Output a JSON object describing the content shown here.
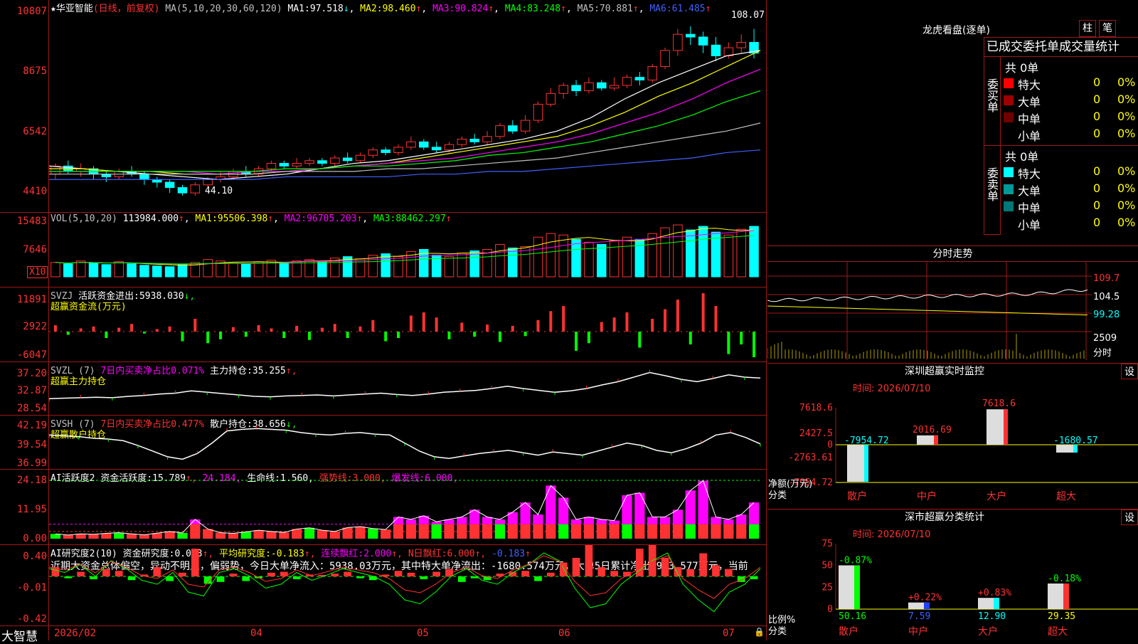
{
  "colors": {
    "up": "#ff3232",
    "down": "#00ffff",
    "ma1": "#ffffff",
    "ma2": "#ffff00",
    "ma3": "#ff00ff",
    "ma4": "#00ff00",
    "ma5": "#c0c0c0",
    "ma6": "#4060ff",
    "grid": "#a01818"
  },
  "kline": {
    "title_star": "★",
    "name": "华亚智能",
    "mode": "(日线，前复权)",
    "ma_spec": "MA(5,10,20,30,60,120)",
    "ma": [
      {
        "label": "MA1:",
        "value": "97.518",
        "arrow": "↓"
      },
      {
        "label": "MA2:",
        "value": "98.460",
        "arrow": "↑"
      },
      {
        "label": "MA3:",
        "value": "90.824",
        "arrow": "↑"
      },
      {
        "label": "MA4:",
        "value": "83.248",
        "arrow": "↑"
      },
      {
        "label": "MA5:",
        "value": "70.881",
        "arrow": "↑"
      },
      {
        "label": "MA6:",
        "value": "61.485",
        "arrow": "↑"
      }
    ],
    "yticks": [
      "10807",
      "8675",
      "6542",
      "4410"
    ],
    "high_label": "108.07",
    "low_label": "44.10",
    "candles": [
      [
        52,
        55,
        50,
        56
      ],
      [
        55,
        53,
        52,
        57
      ],
      [
        53,
        54,
        51,
        56
      ],
      [
        54,
        52,
        50,
        55
      ],
      [
        52,
        51,
        49,
        53
      ],
      [
        51,
        53,
        50,
        54
      ],
      [
        53,
        52,
        51,
        55
      ],
      [
        52,
        50,
        48,
        53
      ],
      [
        50,
        49,
        47,
        51
      ],
      [
        49,
        47,
        45,
        50
      ],
      [
        47,
        45,
        44,
        48
      ],
      [
        45,
        48,
        44,
        49
      ],
      [
        48,
        50,
        47,
        51
      ],
      [
        50,
        51,
        49,
        53
      ],
      [
        51,
        53,
        50,
        54
      ],
      [
        53,
        52,
        51,
        55
      ],
      [
        52,
        54,
        51,
        55
      ],
      [
        54,
        56,
        53,
        57
      ],
      [
        56,
        55,
        54,
        57
      ],
      [
        55,
        56,
        54,
        58
      ],
      [
        56,
        57,
        55,
        58
      ],
      [
        57,
        56,
        55,
        58
      ],
      [
        56,
        58,
        55,
        59
      ],
      [
        58,
        57,
        56,
        60
      ],
      [
        57,
        59,
        56,
        60
      ],
      [
        59,
        61,
        58,
        62
      ],
      [
        61,
        60,
        59,
        62
      ],
      [
        60,
        62,
        59,
        63
      ],
      [
        62,
        64,
        61,
        66
      ],
      [
        64,
        62,
        61,
        65
      ],
      [
        62,
        61,
        60,
        64
      ],
      [
        61,
        63,
        60,
        64
      ],
      [
        63,
        65,
        62,
        66
      ],
      [
        65,
        64,
        63,
        67
      ],
      [
        64,
        66,
        63,
        68
      ],
      [
        66,
        70,
        65,
        71
      ],
      [
        70,
        68,
        67,
        72
      ],
      [
        68,
        72,
        67,
        74
      ],
      [
        72,
        78,
        71,
        79
      ],
      [
        78,
        82,
        77,
        84
      ],
      [
        82,
        85,
        80,
        86
      ],
      [
        85,
        83,
        81,
        87
      ],
      [
        83,
        86,
        82,
        88
      ],
      [
        86,
        84,
        83,
        87
      ],
      [
        84,
        85,
        83,
        88
      ],
      [
        85,
        88,
        84,
        89
      ],
      [
        88,
        87,
        85,
        90
      ],
      [
        87,
        92,
        86,
        93
      ],
      [
        92,
        98,
        91,
        99
      ],
      [
        98,
        104,
        96,
        106
      ],
      [
        104,
        103,
        100,
        107
      ],
      [
        103,
        100,
        97,
        105
      ],
      [
        100,
        96,
        94,
        103
      ],
      [
        96,
        99,
        95,
        101
      ],
      [
        99,
        101,
        97,
        104
      ],
      [
        101,
        97,
        95,
        106
      ]
    ],
    "ma_lines": [
      [
        55,
        54,
        53,
        52,
        51,
        50,
        51,
        52,
        54,
        56,
        57,
        59,
        61,
        63,
        65,
        68,
        73,
        80,
        86,
        91,
        96,
        98
      ],
      [
        54,
        54,
        53,
        53,
        52,
        52,
        52,
        53,
        54,
        55,
        56,
        58,
        60,
        62,
        64,
        66,
        70,
        75,
        81,
        86,
        92,
        98
      ],
      [
        53,
        53,
        53,
        53,
        53,
        52,
        53,
        53,
        54,
        55,
        56,
        57,
        58,
        60,
        62,
        64,
        67,
        71,
        75,
        80,
        86,
        91
      ],
      [
        53,
        53,
        53,
        53,
        53,
        53,
        53,
        54,
        54,
        55,
        55,
        56,
        57,
        59,
        60,
        62,
        64,
        67,
        70,
        74,
        79,
        83
      ],
      [
        52,
        52,
        52,
        52,
        52,
        52,
        52,
        53,
        53,
        53,
        54,
        54,
        55,
        56,
        57,
        58,
        60,
        62,
        64,
        66,
        68,
        71
      ],
      [
        50,
        50,
        50,
        50,
        50,
        50,
        50,
        51,
        51,
        51,
        51,
        52,
        52,
        53,
        53,
        54,
        55,
        56,
        57,
        58,
        60,
        61
      ]
    ]
  },
  "vol": {
    "label": "VOL(5,10,20)",
    "value": "113984.000",
    "arrow": "↑",
    "ma": [
      {
        "label": "MA1:",
        "value": "95506.398",
        "arrow": "↑"
      },
      {
        "label": "MA2:",
        "value": "96705.203",
        "arrow": "↑"
      },
      {
        "label": "MA3:",
        "value": "88462.297",
        "arrow": "↑"
      }
    ],
    "yticks": [
      "15483",
      "7646"
    ],
    "unit": "X10",
    "bars": [
      20,
      18,
      22,
      19,
      17,
      21,
      18,
      16,
      15,
      14,
      17,
      20,
      24,
      22,
      19,
      18,
      21,
      23,
      20,
      22,
      24,
      21,
      26,
      28,
      25,
      30,
      32,
      28,
      35,
      38,
      30,
      28,
      33,
      36,
      38,
      45,
      40,
      42,
      55,
      60,
      58,
      52,
      48,
      45,
      50,
      55,
      52,
      60,
      68,
      72,
      65,
      70,
      62,
      58,
      66,
      70
    ]
  },
  "svzj": {
    "label": "SVZJ",
    "sub1": "活跃资金进出:",
    "v1": "5938.030",
    "a1": "↓,",
    "line2": "超赢资金流(万元)",
    "yticks": [
      "11891",
      "2922",
      "-6047"
    ],
    "bars": [
      1,
      -0.5,
      0.5,
      0.8,
      -1,
      0.6,
      1.2,
      -0.3,
      0.4,
      0.8,
      -1.5,
      2,
      -1.8,
      -1.2,
      0.7,
      -0.8,
      1,
      0.5,
      -1,
      0.9,
      -1.3,
      0.6,
      1.2,
      -1,
      0.8,
      1.8,
      -1.5,
      -1,
      2.5,
      3,
      2.2,
      -1.2,
      1.4,
      -0.8,
      1.1,
      -1.6,
      0.9,
      -0.7,
      1.8,
      3.2,
      4,
      -3,
      -1.8,
      1.5,
      2.2,
      3,
      -2.5,
      2,
      3.5,
      5,
      -2,
      6,
      4,
      -3.5,
      -2,
      -4
    ]
  },
  "svzl": {
    "label": "SVZL",
    "sub1": "(7)",
    "sub2": "7日内买卖净占比0.071%",
    "sub3": "主力持仓:",
    "v3": "35.255",
    "a3": "↑,",
    "line2": "超赢主力持仓",
    "yticks": [
      "37.20",
      "32.87",
      "28.54"
    ],
    "line": [
      30.8,
      30.9,
      31,
      31.1,
      31,
      31.3,
      31.5,
      31.8,
      32,
      32.5,
      32.2,
      31.9,
      31.6,
      31.3,
      31.2,
      31.4,
      31.5,
      31.6,
      31.4,
      31.6,
      31.8,
      32,
      31.7,
      31.5,
      31.8,
      32.2,
      32.4,
      32.6,
      33,
      33.5,
      33,
      32.6,
      32.2,
      32.5,
      33,
      33.8,
      34.5,
      35.5,
      36.5,
      35.8,
      35,
      34.5,
      35.2,
      36,
      35.5,
      35.3
    ]
  },
  "svsh": {
    "label": "SVSH",
    "sub1": "(7)",
    "sub2": "7日内买卖净占比0.477%",
    "sub3": "散户持仓:",
    "v3": "38.656",
    "a3": "↓,",
    "line2": "超赢散户持仓",
    "yticks": [
      "42.19",
      "39.54",
      "36.99"
    ],
    "line": [
      40.5,
      40.4,
      40.3,
      40.1,
      40,
      39.8,
      39.2,
      38.5,
      37.8,
      37.5,
      38.2,
      39.5,
      41,
      41.2,
      41.3,
      41.2,
      41.1,
      40.8,
      40.6,
      40.5,
      40.7,
      40.8,
      40.6,
      40.5,
      39.5,
      38.5,
      37.8,
      37.6,
      37.9,
      38.2,
      38.4,
      38.6,
      38.3,
      38,
      38.4,
      38.2,
      38,
      38.5,
      39,
      39.5,
      39.2,
      38.6,
      38.3,
      38.8,
      39.5,
      40.5,
      40.8,
      40.2,
      39.4
    ]
  },
  "ai": {
    "label": "AI活跃度2",
    "sub1": "资金活跃度:",
    "v1": "15.789",
    "a1": "↑,",
    "v2": "24.184,",
    "sub3": "生命线:",
    "v3": "1.560,",
    "sub4": "强势线:",
    "v4": "3.000,",
    "sub5": "爆发线:",
    "v5": "6.000,",
    "yticks": [
      "24.18",
      "11.95",
      "0.00"
    ],
    "bars": [
      2,
      1.5,
      2,
      1.8,
      2.2,
      2.5,
      2,
      1.6,
      2.3,
      3,
      2.4,
      8,
      4,
      2.5,
      2.2,
      2.8,
      3.5,
      3,
      2.6,
      4,
      4.5,
      3.5,
      3,
      4.6,
      5,
      4.2,
      3.8,
      9,
      8,
      9.5,
      7,
      8,
      9,
      12,
      9,
      8,
      11,
      15,
      10,
      22,
      17,
      8,
      9,
      8,
      7.5,
      18,
      19,
      9,
      9,
      12,
      20,
      24,
      9,
      8,
      10,
      15
    ]
  },
  "ai2": {
    "label": "AI研究度2(10)",
    "sub1": "资金研究度:",
    "v1": "0.023",
    "a1": "↑,",
    "sub2": "平均研究度:",
    "v2": "-0.183",
    "a2": "↑,",
    "sub3": "连续飘红:",
    "v3": "2.000",
    "a3": "↑,",
    "sub4": "N日飘红:",
    "v4": "6.000",
    "a4": "↑,",
    "v5": "-0.183",
    "a5": "↑",
    "comment": "近期大资金总体偏空，异动不明显，偏弱势，今日大单净流入：5938.03万元，其中特大单净流出：-1680.574万元，大单5日累计净出-933.577万元，当前",
    "yticks": [
      "0.40",
      "-0.01",
      "-0.42"
    ],
    "bars": [
      0.1,
      -0.02,
      0.05,
      -0.03,
      0.08,
      0.06,
      -0.04,
      0.02,
      0.1,
      -0.05,
      0.04,
      0.3,
      -0.08,
      -0.06,
      0.03,
      -0.05,
      -0.02,
      0.04,
      0.05,
      -0.03,
      0.02,
      0.01,
      0.03,
      0.05,
      -0.02,
      -0.04,
      0.02,
      0.06,
      0.04,
      -0.03,
      0.05,
      0.08,
      -0.06,
      -0.02,
      -0.04,
      0.03,
      0.05,
      0.06,
      -0.05,
      0.04,
      0.15,
      0.2,
      0.35,
      0.1,
      0.06,
      0.05,
      0.3,
      0.35,
      0.2,
      0.1,
      0.08,
      0.25,
      0.12,
      0.08,
      -0.06,
      -0.03
    ],
    "line": [
      0.1,
      0.05,
      0.15,
      0,
      0.2,
      0.1,
      -0.05,
      -0.1,
      0.05,
      -0.2,
      -0.25,
      0.05,
      0.1,
      0,
      -0.15,
      -0.1,
      0.05,
      -0.05,
      0.02,
      0.1,
      0.05,
      0,
      -0.1,
      -0.3,
      -0.35,
      -0.2,
      0,
      0.1,
      -0.05,
      -0.1,
      0.05,
      0.15,
      0.3,
      0.2,
      -0.15,
      -0.4,
      -0.35,
      -0.1,
      0.05,
      0.2,
      0.3,
      -0.1,
      -0.3,
      -0.45,
      -0.2,
      -0.1,
      0.1
    ]
  },
  "xaxis": {
    "labels": [
      "2026/02",
      "04",
      "05",
      "06",
      "07"
    ]
  },
  "footer": {
    "logo": "大智慧"
  },
  "dragon": {
    "title": "龙虎看盘(逐单)",
    "btn1": "柱",
    "btn2": "笔",
    "header": "已成交委托单成交量统计",
    "buy_label": "委买单",
    "buy_total": "共 0单",
    "buy_rows": [
      {
        "name": "特大",
        "v": "0",
        "p": "0%",
        "c": "#ff0000"
      },
      {
        "name": "大单",
        "v": "0",
        "p": "0%",
        "c": "#a00000"
      },
      {
        "name": "中单",
        "v": "0",
        "p": "0%",
        "c": "#700000"
      },
      {
        "name": "小单",
        "v": "0",
        "p": "0%",
        "c": ""
      }
    ],
    "sell_label": "委卖单",
    "sell_total": "共 0单",
    "sell_rows": [
      {
        "name": "特大",
        "v": "0",
        "p": "0%",
        "c": "#00ffff"
      },
      {
        "name": "大单",
        "v": "0",
        "p": "0%",
        "c": "#009999"
      },
      {
        "name": "中单",
        "v": "0",
        "p": "0%",
        "c": "#007777"
      },
      {
        "name": "小单",
        "v": "0",
        "p": "0%",
        "c": ""
      }
    ]
  },
  "intraday": {
    "title": "分时走势",
    "yticks": [
      "109.7",
      "104.5",
      "99.28"
    ],
    "vol_tick": "2509",
    "foot": "分时"
  },
  "monitor": {
    "title": "深圳超赢实时监控",
    "btn": "设",
    "time": "时间: 2026/07/10",
    "yticks": [
      "7618.6",
      "2427.5",
      "0",
      "-2763.61",
      "-7954.72"
    ],
    "ylabel1": "净额(万元)",
    "ylabel2": "分类",
    "bars": [
      {
        "cat": "散户",
        "value": -7954.72,
        "label": "-7954.72",
        "color": "#00ffff"
      },
      {
        "cat": "中户",
        "value": 2016.69,
        "label": "2016.69",
        "color": "#ff3232"
      },
      {
        "cat": "大户",
        "value": 7618.6,
        "label": "7618.6",
        "color": "#ff3232"
      },
      {
        "cat": "超大",
        "value": -1680.57,
        "label": "-1680.57",
        "color": "#00ffff"
      }
    ]
  },
  "classify": {
    "title": "深市超赢分类统计",
    "btn": "设",
    "time": "时间: 2026/07/10",
    "yticks": [
      "75",
      "50",
      "25",
      "0"
    ],
    "ylabel1": "比例%",
    "ylabel2": "分类",
    "bars": [
      {
        "cat": "散户",
        "value": 50.16,
        "label": "50.16",
        "chg": "-0.87%",
        "color": "#00ff00",
        "chgc": "#00ff00"
      },
      {
        "cat": "中户",
        "value": 7.59,
        "label": "7.59",
        "chg": "+0.22%",
        "color": "#2040ff",
        "chgc": "#ff3232"
      },
      {
        "cat": "大户",
        "value": 12.9,
        "label": "12.90",
        "chg": "+0.83%",
        "color": "#00ffff",
        "chgc": "#ff3232"
      },
      {
        "cat": "超大",
        "value": 29.35,
        "label": "29.35",
        "chg": "-0.18%",
        "color": "#ff3232",
        "chgc": "#00ff00"
      }
    ]
  }
}
